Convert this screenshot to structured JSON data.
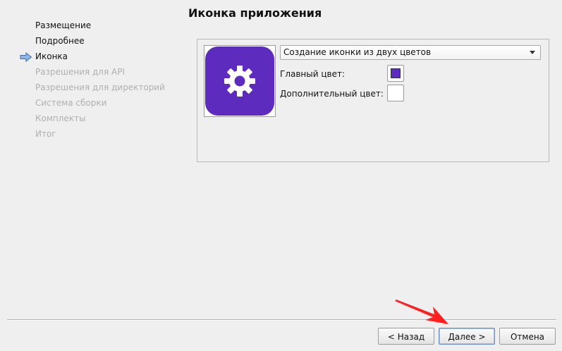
{
  "header": {
    "title": "Иконка приложения"
  },
  "steps": {
    "items": [
      {
        "label": "Размещение"
      },
      {
        "label": "Подробнее"
      },
      {
        "label": "Иконка"
      },
      {
        "label": "Разрешения для API"
      },
      {
        "label": "Разрешения для директорий"
      },
      {
        "label": "Система сборки"
      },
      {
        "label": "Комплекты"
      },
      {
        "label": "Итог"
      }
    ],
    "current_index": 2,
    "current_marker_icon": "arrow-right-icon"
  },
  "icon_settings": {
    "preview_icon": "gear-icon",
    "mode_select": {
      "value": "Создание иконки из двух цветов"
    },
    "primary_color": {
      "label": "Главный цвет:",
      "value": "#5e2bbf"
    },
    "secondary_color": {
      "label": "Дополнительный цвет:",
      "value": "#ffffff"
    }
  },
  "footer": {
    "back_label": "< Назад",
    "next_label": "Далее >",
    "cancel_label": "Отмена"
  },
  "annotation": {
    "pointer_color": "#ff1f1f"
  }
}
